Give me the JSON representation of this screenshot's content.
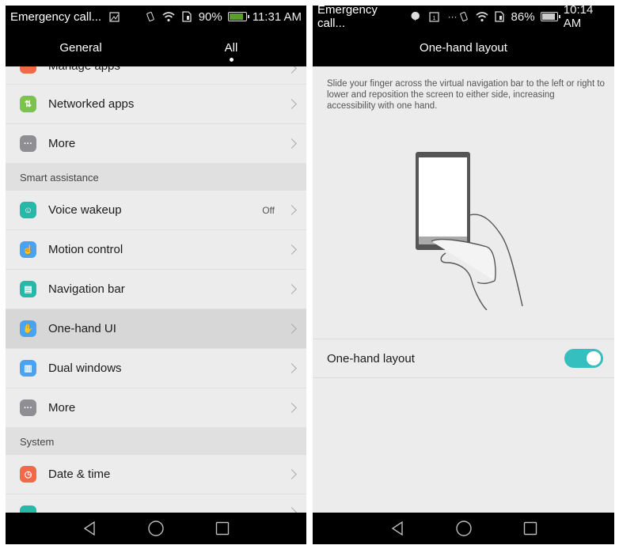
{
  "left_screen": {
    "status_bar": {
      "carrier_text": "Emergency call...",
      "notification_icons": [
        "image-icon"
      ],
      "system_icons": [
        "vibrate-icon",
        "wifi-icon",
        "sim-icon"
      ],
      "battery_percent": "90%",
      "battery_level": 0.9,
      "battery_charging": true,
      "time": "11:31 AM"
    },
    "tabs": [
      {
        "label": "General",
        "active": false
      },
      {
        "label": "All",
        "active": true
      }
    ],
    "list": {
      "partial_top_item": {
        "label": "Manage apps",
        "icon": "manage-apps-icon",
        "icon_color": "#f06a4a"
      },
      "items_group1": [
        {
          "label": "Networked apps",
          "icon": "networked-apps-icon",
          "icon_glyph": "⇅",
          "icon_color": "#7dc24b"
        },
        {
          "label": "More",
          "icon": "more-icon",
          "icon_glyph": "···",
          "icon_color": "#8e8e93"
        }
      ],
      "section_smart": "Smart assistance",
      "items_smart": [
        {
          "label": "Voice wakeup",
          "value": "Off",
          "icon": "voice-wakeup-icon",
          "icon_glyph": "☺",
          "icon_color": "#27b9a7"
        },
        {
          "label": "Motion control",
          "icon": "motion-control-icon",
          "icon_glyph": "☝",
          "icon_color": "#4aa3f0"
        },
        {
          "label": "Navigation bar",
          "icon": "navigation-bar-icon",
          "icon_glyph": "▤",
          "icon_color": "#27b9a7"
        },
        {
          "label": "One-hand UI",
          "icon": "one-hand-ui-icon",
          "icon_glyph": "✋",
          "icon_color": "#4aa3f0",
          "selected": true
        },
        {
          "label": "Dual windows",
          "icon": "dual-windows-icon",
          "icon_glyph": "▥",
          "icon_color": "#4aa3f0"
        },
        {
          "label": "More",
          "icon": "more-icon",
          "icon_glyph": "···",
          "icon_color": "#8e8e93"
        }
      ],
      "section_system": "System",
      "items_system": [
        {
          "label": "Date & time",
          "icon": "clock-icon",
          "icon_glyph": "◷",
          "icon_color": "#f06a4a"
        }
      ],
      "partial_bottom_icon_color": "#27b9a7"
    },
    "nav": {
      "back": "back-icon",
      "home": "home-icon",
      "recents": "recents-icon"
    }
  },
  "right_screen": {
    "status_bar": {
      "carrier_text": "Emergency call...",
      "notification_icons": [
        "hangouts-icon",
        "calendar-icon",
        "more-notifications-icon"
      ],
      "calendar_day": "1",
      "system_icons": [
        "vibrate-icon",
        "wifi-icon",
        "sim-icon"
      ],
      "battery_percent": "86%",
      "battery_level": 0.86,
      "battery_charging": false,
      "time": "10:14 AM"
    },
    "title": "One-hand layout",
    "description": "Slide your finger across the virtual navigation bar to the left or right to lower and reposition the screen to either side, increasing accessibility with one hand.",
    "toggle": {
      "label": "One-hand layout",
      "on": true,
      "color": "#36bfbf"
    },
    "nav": {
      "back": "back-icon",
      "home": "home-icon",
      "recents": "recents-icon"
    }
  }
}
